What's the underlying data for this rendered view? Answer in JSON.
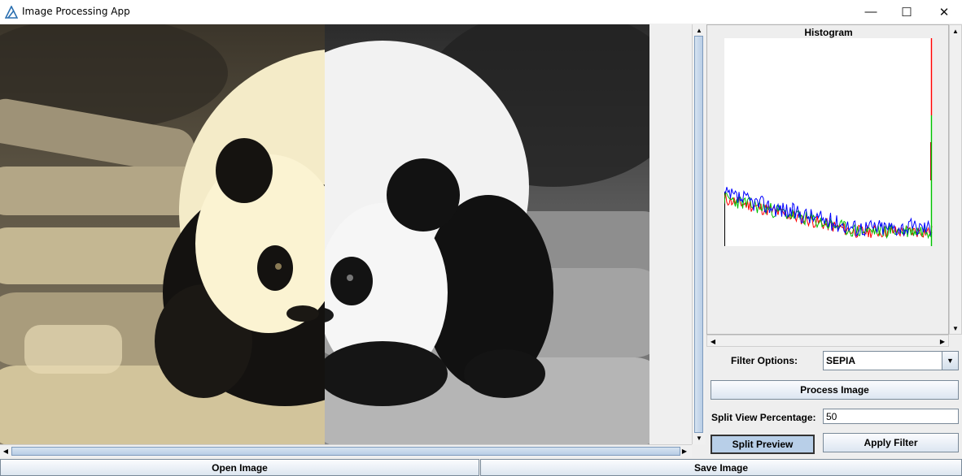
{
  "window": {
    "title": "Image Processing App",
    "controls": {
      "minimize": "—",
      "maximize": "☐",
      "close": "✕"
    }
  },
  "image": {
    "subject": "giant panda cub on logs",
    "filter_preview": "SEPIA",
    "split_percentage": 50
  },
  "histogram": {
    "title": "Histogram",
    "colors": {
      "red": "#ff0000",
      "green": "#00cc00",
      "blue": "#0000ff"
    }
  },
  "controls": {
    "filter_label": "Filter Options:",
    "filter_value": "SEPIA",
    "process_button": "Process Image",
    "split_label": "Split View Percentage:",
    "split_value": "50",
    "split_preview_button": "Split Preview",
    "apply_filter_button": "Apply Filter"
  },
  "bottom": {
    "open_button": "Open Image",
    "save_button": "Save Image"
  }
}
